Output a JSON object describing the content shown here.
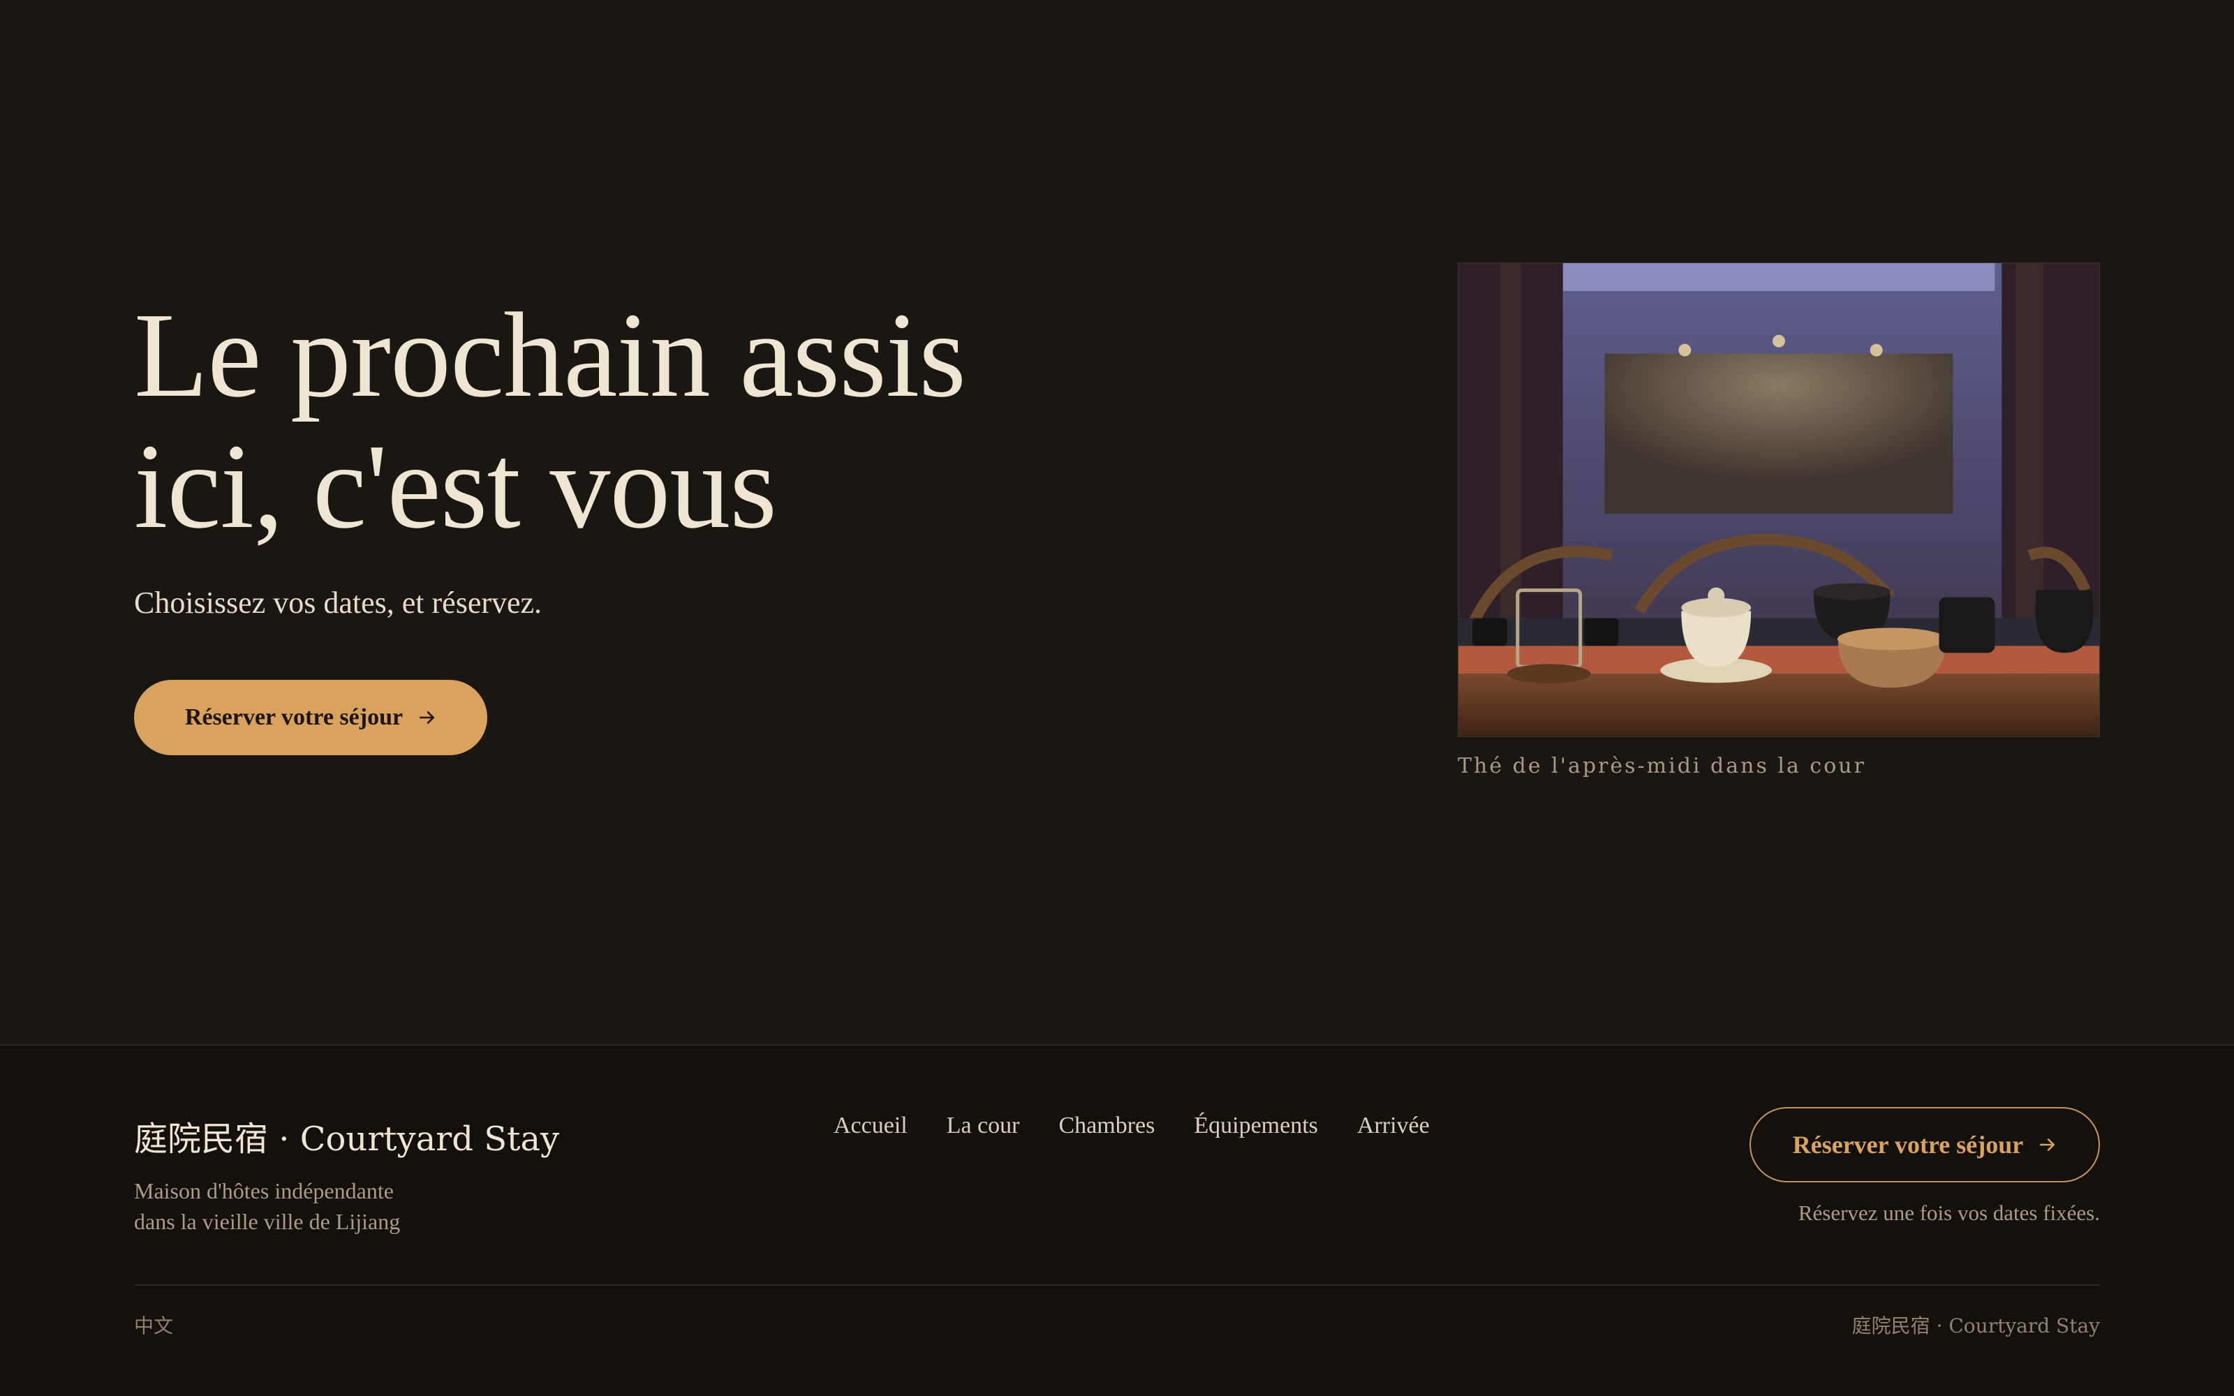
{
  "hero": {
    "title_line1": "Le prochain assis",
    "title_line2": "ici, c'est vous",
    "subtitle": "Choisissez vos dates, et réservez.",
    "cta_label": "Réserver votre séjour",
    "cta_icon": "arrow-right-icon",
    "image_caption": "Thé de l'après-midi dans la cour"
  },
  "footer": {
    "brand": "庭院民宿 · Courtyard Stay",
    "brand_desc_line1": "Maison d'hôtes indépendante",
    "brand_desc_line2": "dans la vieille ville de Lijiang",
    "nav": [
      {
        "label": "Accueil"
      },
      {
        "label": "La cour"
      },
      {
        "label": "Chambres"
      },
      {
        "label": "Équipements"
      },
      {
        "label": "Arrivée"
      }
    ],
    "cta_label": "Réserver votre séjour",
    "cta_note": "Réservez une fois vos dates fixées.",
    "language": "中文",
    "copyright": "庭院民宿 · Courtyard Stay"
  },
  "colors": {
    "background": "#1a1611",
    "footer_background": "#14110d",
    "accent": "#d9a35f",
    "text": "#efe5d3",
    "muted": "#a99c88"
  }
}
